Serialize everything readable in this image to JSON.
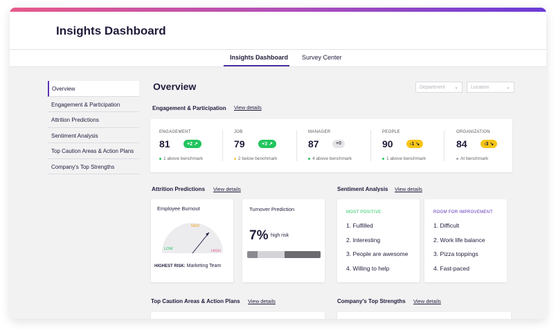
{
  "header": {
    "title": "Insights Dashboard"
  },
  "tabs": [
    {
      "label": "Insights Dashboard",
      "active": true
    },
    {
      "label": "Survey Center",
      "active": false
    }
  ],
  "sidebar": {
    "items": [
      {
        "label": "Overview",
        "active": true
      },
      {
        "label": "Engagement & Participation"
      },
      {
        "label": "Attrition Predictions"
      },
      {
        "label": "Sentiment Analysis"
      },
      {
        "label": "Top Caution Areas & Action Plans"
      },
      {
        "label": "Company's Top Strengths"
      }
    ]
  },
  "main": {
    "title": "Overview",
    "filters": {
      "department": "Department",
      "location": "Location"
    },
    "view_details": "View details",
    "engagement": {
      "title": "Engagement & Participation",
      "metrics": [
        {
          "label": "ENGAGEMENT",
          "value": "81",
          "badge": "+2",
          "badge_color": "#22c55e",
          "bench": "1 above benchmark",
          "dot": "#22c55e"
        },
        {
          "label": "JOB",
          "value": "79",
          "badge": "+3",
          "badge_color": "#22c55e",
          "bench": "2 below benchmark",
          "dot": "#f5c542"
        },
        {
          "label": "MANAGER",
          "value": "87",
          "badge": "+0",
          "badge_color": "#e5e5e9",
          "bench": "4 above benchmark",
          "dot": "#22c55e"
        },
        {
          "label": "PEOPLE",
          "value": "90",
          "badge": "-1",
          "badge_color": "#f5c518",
          "bench": "1 above benchmark",
          "dot": "#22c55e"
        },
        {
          "label": "ORGANIZATION",
          "value": "84",
          "badge": "-3",
          "badge_color": "#f5c518",
          "bench": "At benchmark",
          "dot": "#9ca3af"
        }
      ]
    },
    "attrition": {
      "title": "Attrition Predictions",
      "burnout": {
        "title": "Employee Burnout",
        "low": "LOW",
        "med": "MED",
        "high": "HIGH",
        "risk_label": "HIGHEST RISK:",
        "risk_value": "Marketing Team"
      },
      "turnover": {
        "title": "Turnover Prediction",
        "value": "7%",
        "risk": "high risk"
      }
    },
    "sentiment": {
      "title": "Sentiment Analysis",
      "positive": {
        "head": "MOST POSITIVE:",
        "items": [
          "1. Fulfilled",
          "2. Interesting",
          "3. People are awesome",
          "4. Willing to help"
        ]
      },
      "improve": {
        "head": "ROOM FOR IMPROVEMENT:",
        "items": [
          "1. Difficult",
          "2. Work life balance",
          "3. Pizza toppings",
          "4. Fast-paced"
        ]
      }
    },
    "caution": {
      "title": "Top Caution Areas & Action Plans"
    },
    "strengths": {
      "title": "Company's Top Strengths"
    }
  },
  "colors": {
    "accent": "#5b2fb5",
    "positive": "#22c55e",
    "warning": "#f5c518",
    "positive_head": "#22c55e",
    "improve_head": "#5b2fb5"
  }
}
